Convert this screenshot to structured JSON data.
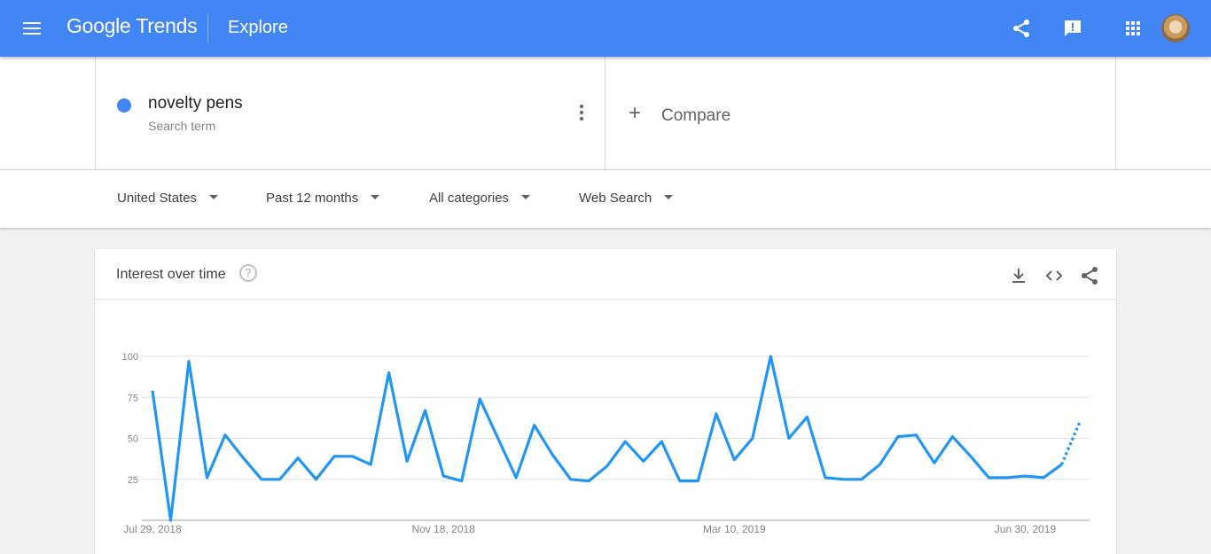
{
  "header": {
    "logo_google": "Google",
    "logo_trends": "Trends",
    "page": "Explore",
    "colors": {
      "bar": "#4285f4"
    },
    "icons": [
      "menu-icon",
      "share-icon",
      "feedback-icon",
      "apps-icon",
      "account-avatar"
    ]
  },
  "term": {
    "name": "novelty pens",
    "type": "Search term",
    "color": "#4285f4"
  },
  "compare": {
    "label": "Compare"
  },
  "filters": {
    "region": "United States",
    "time": "Past 12 months",
    "category": "All categories",
    "property": "Web Search"
  },
  "card": {
    "title": "Interest over time",
    "help": "?",
    "icons": [
      "download-icon",
      "embed-icon",
      "share-icon"
    ]
  },
  "chart_data": {
    "type": "line",
    "title": "",
    "xlabel": "",
    "ylabel": "",
    "ylim": [
      0,
      100
    ],
    "yticks": [
      25,
      50,
      75,
      100
    ],
    "x_tick_labels": [
      {
        "label": "Jul 29, 2018",
        "index": 0
      },
      {
        "label": "Nov 18, 2018",
        "index": 16
      },
      {
        "label": "Mar 10, 2019",
        "index": 32
      },
      {
        "label": "Jun 30, 2019",
        "index": 48
      }
    ],
    "grid": true,
    "series": [
      {
        "color": "#2196f3",
        "values": [
          79,
          0,
          97,
          26,
          52,
          38,
          25,
          25,
          38,
          25,
          39,
          39,
          34,
          90,
          36,
          67,
          27,
          24,
          74,
          50,
          26,
          58,
          40,
          25,
          24,
          33,
          48,
          36,
          48,
          24,
          24,
          65,
          37,
          50,
          100,
          50,
          63,
          26,
          25,
          25,
          34,
          51,
          52,
          35,
          51,
          39,
          26,
          26,
          27,
          26,
          34,
          60
        ],
        "partial_from_index": 50
      }
    ]
  }
}
